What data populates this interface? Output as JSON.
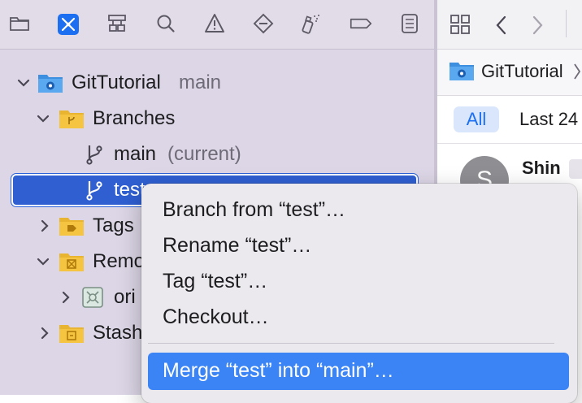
{
  "navigator": {
    "toolbar_icons": [
      "folder-icon",
      "source-control-icon",
      "hierarchy-icon",
      "search-icon",
      "warning-icon",
      "test-diamond-icon",
      "debug-spray-icon",
      "breakpoint-tag-icon",
      "report-list-icon"
    ],
    "tree": {
      "project_name": "GitTutorial",
      "project_branch": "main",
      "branches_label": "Branches",
      "main_branch": "main",
      "main_branch_suffix": "(current)",
      "selected_branch": "test",
      "tags_label": "Tags",
      "remotes_label": "Remo",
      "origin_label": "ori",
      "stashes_label": "Stash"
    }
  },
  "editor": {
    "path_label": "GitTutorial",
    "filter_all": "All",
    "filter_last": "Last 24",
    "commit_author": "Shin",
    "avatar_letter": "S"
  },
  "context_menu": {
    "items": [
      "Branch from “test”…",
      "Rename “test”…",
      "Tag “test”…",
      "Checkout…"
    ],
    "highlighted_item": "Merge “test” into “main”…"
  },
  "colors": {
    "accent": "#1c6ff0",
    "selection": "#2f5fd1",
    "menu_highlight": "#3b84f5",
    "folder_yellow": "#f5c542",
    "folder_blue": "#3d8fe0"
  }
}
